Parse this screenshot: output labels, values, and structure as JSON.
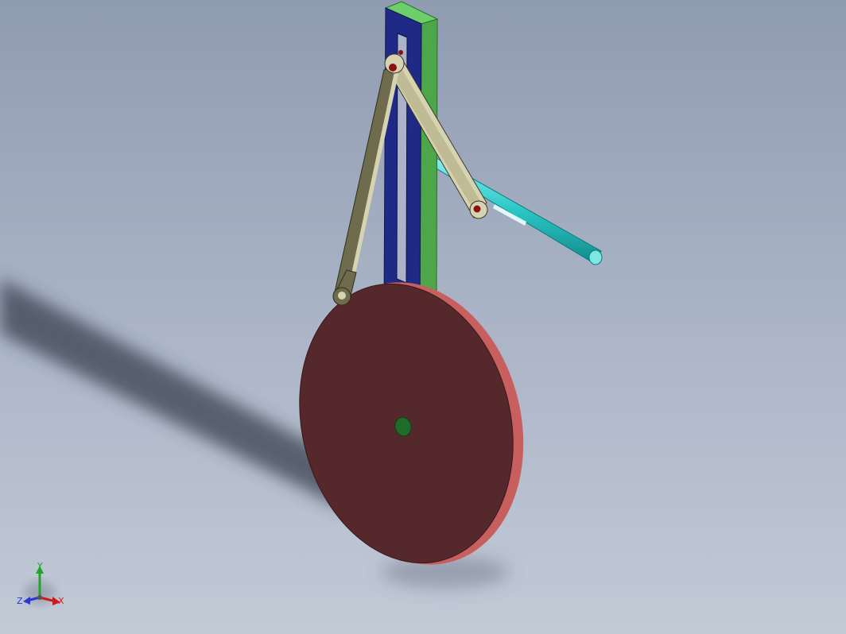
{
  "triad": {
    "x_label": "X",
    "y_label": "Y",
    "z_label": "Z"
  },
  "colors": {
    "background_top": "#8e9bb1",
    "background_bottom": "#bdc6d3",
    "frame_front": "#1f2a86",
    "frame_side": "#4da64a",
    "frame_top": "#6ccf69",
    "link": "#6f6c4d",
    "link_light": "#d6d3b2",
    "pin": "#8b1010",
    "axle": "#2cc7c7",
    "disk_face": "#55282b",
    "disk_rim": "#c85f5f",
    "disk_hub": "#1f6b2a",
    "axis_x": "#d01a1a",
    "axis_y": "#24a32a",
    "axis_z": "#2a35d6"
  }
}
